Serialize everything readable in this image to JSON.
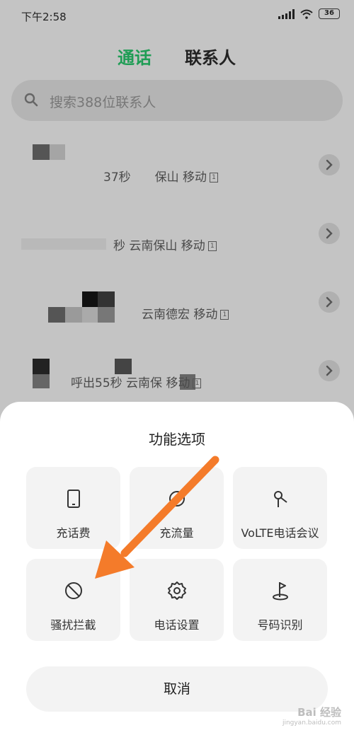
{
  "status_bar": {
    "time": "下午2:58",
    "battery": "36"
  },
  "tabs": {
    "calls": "通话",
    "contacts": "联系人"
  },
  "search": {
    "placeholder": "搜索388位联系人"
  },
  "call_log": [
    {
      "detail": "37秒",
      "location": "保山 移动"
    },
    {
      "detail": "秒",
      "location": "云南保山 移动"
    },
    {
      "detail": "",
      "location": "云南德宏 移动"
    },
    {
      "detail": "呼出55秒",
      "location": "云南保 移动"
    }
  ],
  "sheet": {
    "title": "功能选项",
    "options": [
      {
        "label": "充话费",
        "icon": "phone-device-icon"
      },
      {
        "label": "充流量",
        "icon": "data-flow-icon"
      },
      {
        "label": "VoLTE电话会议",
        "icon": "conference-icon"
      },
      {
        "label": "骚扰拦截",
        "icon": "block-icon"
      },
      {
        "label": "电话设置",
        "icon": "gear-icon"
      },
      {
        "label": "号码识别",
        "icon": "flag-pin-icon"
      }
    ],
    "cancel_label": "取消"
  },
  "annotation": {
    "arrow_color": "#f47b2a",
    "target": "骚扰拦截"
  },
  "watermark": {
    "brand": "Bai 经验",
    "url": "jingyan.baidu.com"
  },
  "colors": {
    "accent_green": "#1f9d55",
    "overlay_gray": "#c4c4c4",
    "sheet_bg": "#ffffff",
    "tile_bg": "#f3f3f3"
  }
}
